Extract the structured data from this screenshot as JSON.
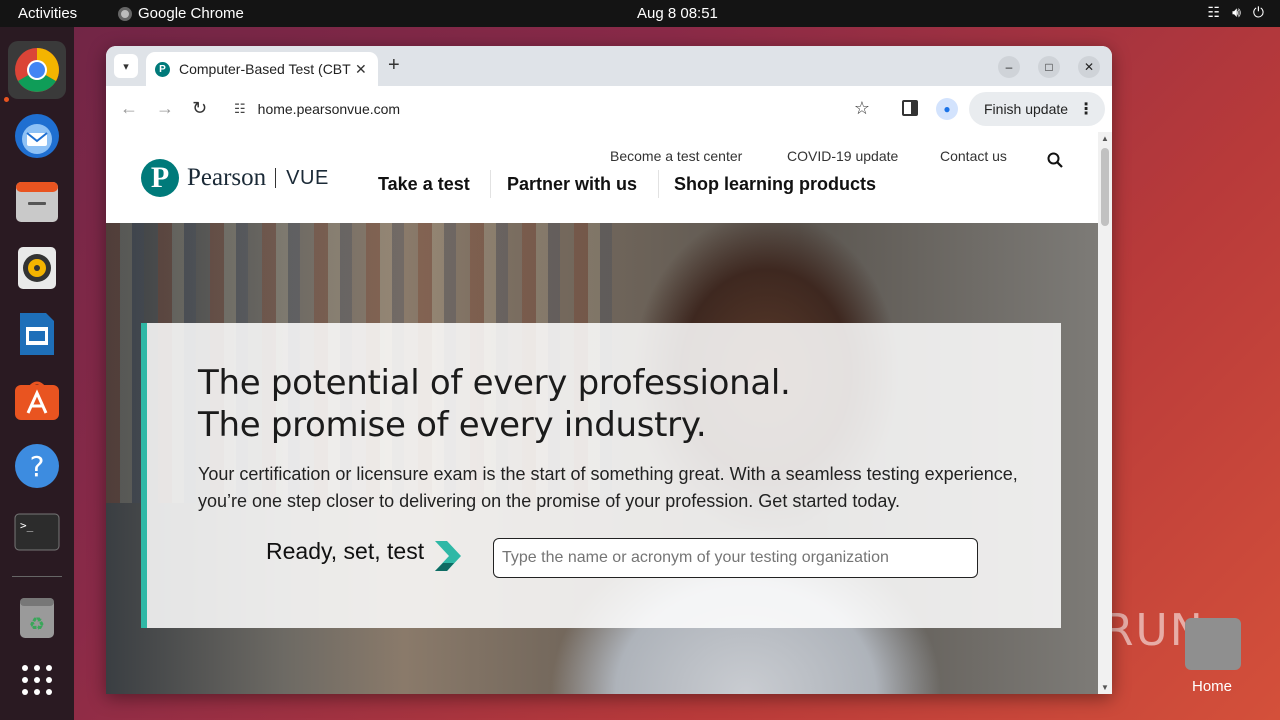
{
  "topbar": {
    "activities": "Activities",
    "app_name": "Google Chrome",
    "clock": "Aug 8  08:51"
  },
  "dock": {
    "items": [
      "chrome-icon",
      "thunderbird-icon",
      "files-icon",
      "rhythmbox-icon",
      "writer-icon",
      "app-center-icon",
      "help-icon",
      "terminal-icon",
      "trash-icon",
      "app-grid-icon"
    ]
  },
  "desktop": {
    "home_label": "Home",
    "watermark": "ANY.RUN"
  },
  "browser": {
    "tab_title": "Computer-Based Test (CBT)",
    "url": "home.pearsonvue.com",
    "finish_update": "Finish update"
  },
  "site": {
    "logo_brand": "Pearson",
    "logo_product": "VUE",
    "utility_links": [
      "Become a test center",
      "COVID-19 update",
      "Contact us"
    ],
    "nav": [
      "Take a test",
      "Partner with us",
      "Shop learning products"
    ],
    "hero": {
      "headline_line1": "The potential of every professional.",
      "headline_line2": "The promise of every industry.",
      "subcopy": "Your certification or licensure exam is the start of something great. With a seamless testing experience, you’re one step closer to delivering on the promise of your profession. Get started today.",
      "ready_label": "Ready, set, test",
      "search_placeholder": "Type the name or acronym of your testing organization"
    }
  },
  "colors": {
    "accent_teal": "#2fb8a6",
    "pearson_brand": "#007a7a",
    "ubuntu_orange": "#e95420"
  }
}
